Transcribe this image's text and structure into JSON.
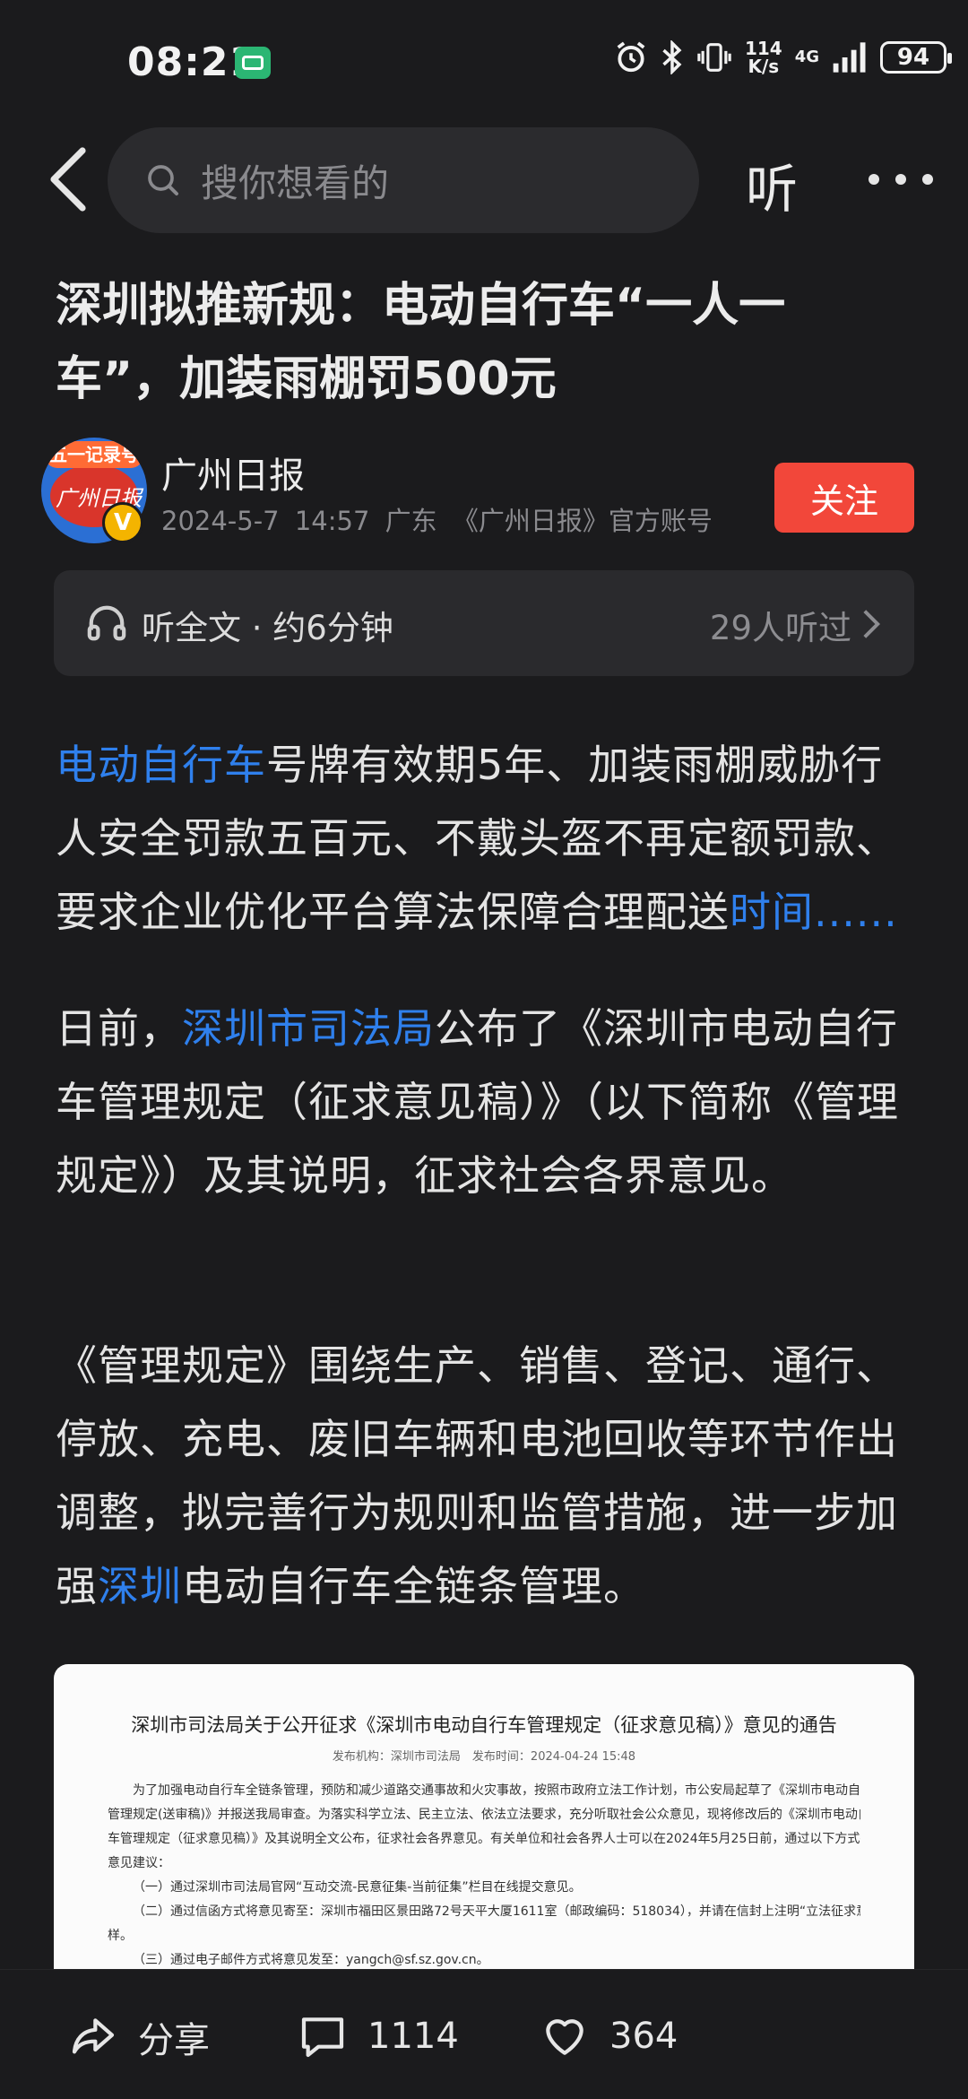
{
  "status_bar": {
    "time": "08:21",
    "speed_value": "114",
    "speed_unit": "K/s",
    "network": "4G",
    "battery": "94"
  },
  "top_bar": {
    "search_placeholder": "搜你想看的",
    "listen_label": "听"
  },
  "article": {
    "headline_line1": "深圳拟推新规：电动自行车“一人一",
    "headline_line2": "车”，加装雨棚罚500元",
    "author": {
      "name": "广州日报",
      "date": "2024-5-7",
      "time": "14:57",
      "location": "广东",
      "account": "《广州日报》官方账号",
      "avatar_ribbon": "五一记录号",
      "avatar_text": "广州日报",
      "verified": "V"
    },
    "follow_label": "关注",
    "listen_bar": {
      "label": "听全文 · 约6分钟",
      "count": "29人听过"
    },
    "p1": {
      "link1": "电动自行车",
      "text": "号牌有效期5年、加装雨棚威胁行人安全罚款五百元、不戴头盔不再定额罚款、要求企业优化平台算法保障合理配送",
      "link2": "时间......"
    },
    "p2": {
      "pre": "日前，",
      "link": "深圳市司法局",
      "text": "公布了《深圳市电动自行车管理规定（征求意见稿）》（以下简称《管理规定》）及其说明，征求社会各界意见。"
    },
    "p3": {
      "text1": "《管理规定》围绕生产、销售、登记、通行、停放、充电、废旧车辆和电池回收等环节作出调整，拟完善行为规则和监管措施，进一步加强",
      "link": "深圳",
      "text2": "电动自行车全链条管理。"
    },
    "doc_image": {
      "title": "深圳市司法局关于公开征求《深圳市电动自行车管理规定（征求意见稿）》意见的通告",
      "meta": "发布机构：深圳市司法局　发布时间：2024-04-24 15:48",
      "lines": [
        "为了加强电动自行车全链条管理，预防和减少道路交通事故和火灾事故，按照市政府立法工作计划，市公安局起草了《深圳市电动自行车",
        "管理规定(送审稿)》并报送我局审查。为落实科学立法、民主立法、依法立法要求，充分听取社会公众意见，现将修改后的《深圳市电动自行",
        "车管理规定（征求意见稿）》及其说明全文公布，征求社会各界意见。有关单位和社会各界人士可以在2024年5月25日前，通过以下方式提出",
        "意见建议：",
        "（一）通过深圳市司法局官网“互动交流-民意征集-当前征集”栏目在线提交意见。",
        "（二）通过信函方式将意见寄至：深圳市福田区景田路72号天平大厦1611室（邮政编码：518034），并请在信封上注明“立法征求意见”字",
        "样。",
        "（三）通过电子邮件方式将意见发至：yangch@sf.sz.gov.cn。"
      ]
    }
  },
  "bottom_bar": {
    "share_label": "分享",
    "comments": "1114",
    "likes": "364"
  },
  "colors": {
    "background": "#1b1b1d",
    "link": "#2f80ed",
    "follow_button": "#f2473a"
  }
}
